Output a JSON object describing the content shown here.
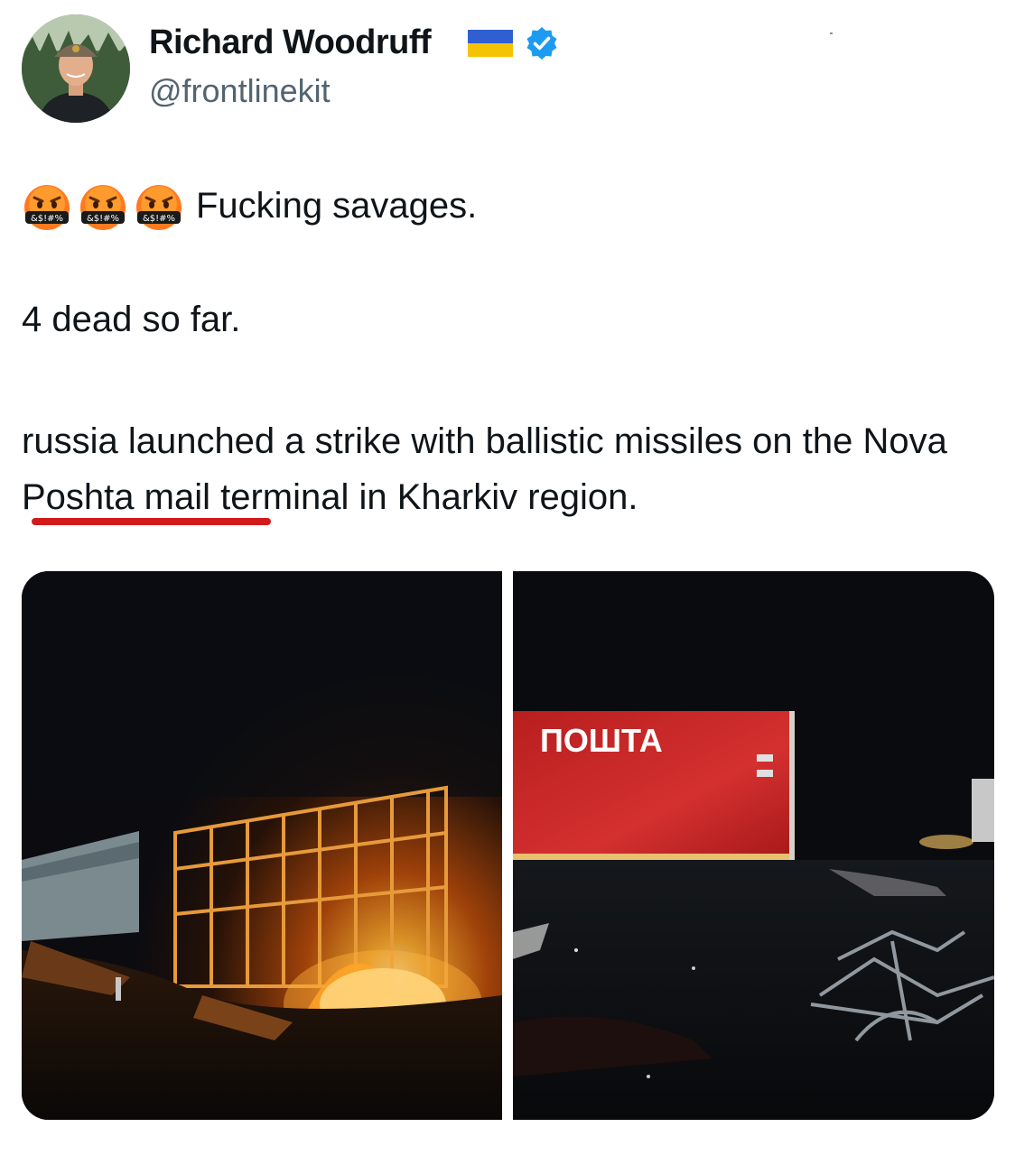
{
  "author": {
    "name": "Richard Woodruff",
    "handle": "@frontlinekit",
    "flag_icon": "ukraine-flag",
    "badge_icon": "verified-badge",
    "badge_color": "#1d9bf0"
  },
  "tweet": {
    "emoji_icon": "face-with-symbols-on-mouth",
    "emoji_count": 3,
    "emoji_symbols": "&$!#%",
    "line1": "Fucking savages.",
    "line2": "4 dead so far.",
    "line3": "russia launched a strike with ballistic missiles on the Nova Poshta mail terminal in Kharkiv region.",
    "underline_color": "#d11a1a"
  },
  "media": {
    "photo2_sign_text": "ПОШТА"
  }
}
